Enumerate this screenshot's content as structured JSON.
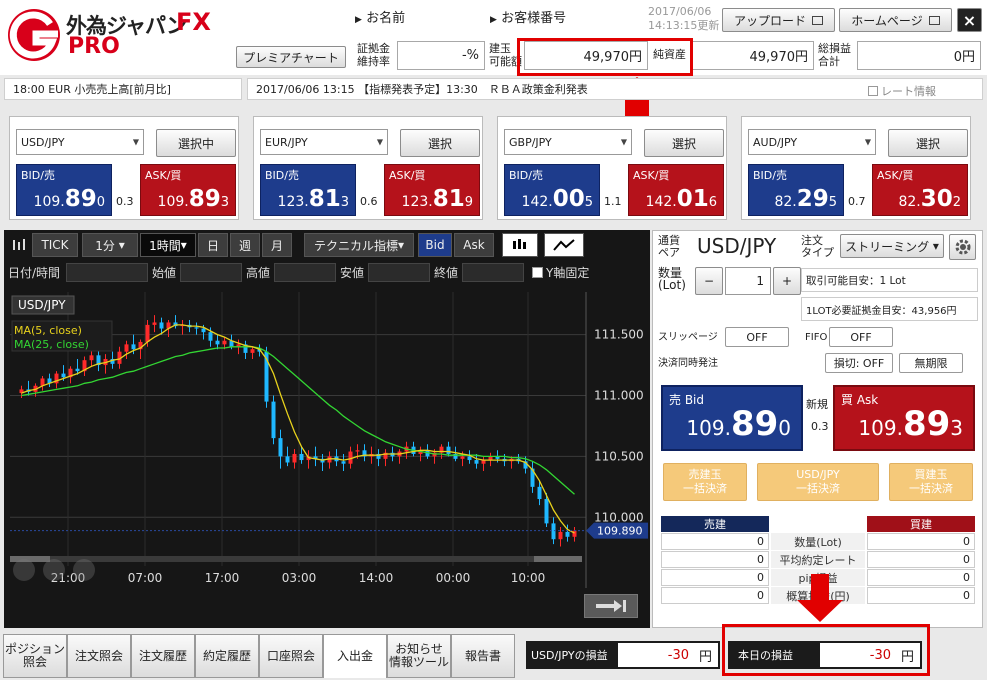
{
  "app": {
    "logo_main": "外為ジャパン",
    "logo_fx": "FX",
    "logo_pro": "PRO"
  },
  "header": {
    "name_label": "お名前",
    "customer_no_label": "お客様番号",
    "update_date": "2017/06/06",
    "update_time": "14:13:15更新",
    "upload_btn": "アップロード",
    "homepage_btn": "ホームページ",
    "close_btn": "×",
    "premier_chart_btn": "プレミアチャート",
    "margin_rate_label1": "証拠金",
    "margin_rate_label2": "維持率",
    "margin_rate_value": "-%",
    "position_avail_label1": "建玉",
    "position_avail_label2": "可能額",
    "position_avail_value": "49,970円",
    "net_assets_label": "純資産",
    "net_assets_value": "49,970円",
    "total_pl_label1": "総損益",
    "total_pl_label2": "合計",
    "total_pl_value": "0円"
  },
  "news": {
    "left": "18:00  EUR  小売売上高[前月比]",
    "main": "2017/06/06 13:15 【指標発表予定】13:30　ＲＢＡ政策金利発表",
    "rate_info_label": "レート情報"
  },
  "panels": [
    {
      "pair": "USD/JPY",
      "button": "選択中",
      "bid_label": "BID/売",
      "bid": [
        "109.",
        "89",
        "0"
      ],
      "ask_label": "ASK/買",
      "ask": [
        "109.",
        "89",
        "3"
      ],
      "spread": "0.3"
    },
    {
      "pair": "EUR/JPY",
      "button": "選択",
      "bid_label": "BID/売",
      "bid": [
        "123.",
        "81",
        "3"
      ],
      "ask_label": "ASK/買",
      "ask": [
        "123.",
        "81",
        "9"
      ],
      "spread": "0.6"
    },
    {
      "pair": "GBP/JPY",
      "button": "選択",
      "bid_label": "BID/売",
      "bid": [
        "142.",
        "00",
        "5"
      ],
      "ask_label": "ASK/買",
      "ask": [
        "142.",
        "01",
        "6"
      ],
      "spread": "1.1"
    },
    {
      "pair": "AUD/JPY",
      "button": "選択",
      "bid_label": "BID/売",
      "bid": [
        "82.",
        "29",
        "5"
      ],
      "ask_label": "ASK/買",
      "ask": [
        "82.",
        "30",
        "2"
      ],
      "spread": "0.7"
    }
  ],
  "chart_toolbar": {
    "tick": "TICK",
    "minute": "1分",
    "hour": "1時間",
    "day": "日",
    "week": "週",
    "month": "月",
    "technical": "テクニカル指標",
    "bid": "Bid",
    "ask": "Ask"
  },
  "ohlc": {
    "datetime": "日付/時間",
    "open": "始値",
    "high": "高値",
    "low": "安値",
    "close": "終値",
    "y_fixed": "Y軸固定"
  },
  "chart_data": {
    "type": "line",
    "symbol": "USD/JPY",
    "series": [
      {
        "name": "MA(5, close)",
        "color": "#e8d21c"
      },
      {
        "name": "MA(25, close)",
        "color": "#33d633"
      }
    ],
    "yticks": [
      "111.500",
      "111.000",
      "110.500",
      "110.000"
    ],
    "xticks": [
      "21:00",
      "07:00",
      "17:00",
      "03:00",
      "14:00",
      "00:00",
      "10:00"
    ],
    "ylim": [
      109.6,
      111.85
    ],
    "current_price": "109.890",
    "candles": [
      [
        111.02,
        111.08,
        110.98,
        111.05
      ],
      [
        111.05,
        111.12,
        111.0,
        111.03
      ],
      [
        111.03,
        111.1,
        110.99,
        111.08
      ],
      [
        111.08,
        111.16,
        111.04,
        111.14
      ],
      [
        111.14,
        111.18,
        111.07,
        111.1
      ],
      [
        111.1,
        111.2,
        111.06,
        111.18
      ],
      [
        111.18,
        111.25,
        111.12,
        111.15
      ],
      [
        111.15,
        111.24,
        111.1,
        111.22
      ],
      [
        111.22,
        111.3,
        111.17,
        111.2
      ],
      [
        111.2,
        111.32,
        111.16,
        111.29
      ],
      [
        111.29,
        111.38,
        111.24,
        111.33
      ],
      [
        111.33,
        111.4,
        111.2,
        111.25
      ],
      [
        111.25,
        111.34,
        111.18,
        111.3
      ],
      [
        111.3,
        111.36,
        111.22,
        111.26
      ],
      [
        111.26,
        111.4,
        111.22,
        111.36
      ],
      [
        111.36,
        111.45,
        111.3,
        111.42
      ],
      [
        111.42,
        111.5,
        111.34,
        111.38
      ],
      [
        111.38,
        111.46,
        111.3,
        111.44
      ],
      [
        111.44,
        111.62,
        111.4,
        111.58
      ],
      [
        111.58,
        111.66,
        111.52,
        111.6
      ],
      [
        111.6,
        111.64,
        111.5,
        111.55
      ],
      [
        111.55,
        111.62,
        111.48,
        111.6
      ],
      [
        111.6,
        111.66,
        111.55,
        111.57
      ],
      [
        111.57,
        111.62,
        111.5,
        111.58
      ],
      [
        111.58,
        111.62,
        111.52,
        111.56
      ],
      [
        111.56,
        111.6,
        111.5,
        111.55
      ],
      [
        111.55,
        111.58,
        111.46,
        111.52
      ],
      [
        111.52,
        111.56,
        111.4,
        111.45
      ],
      [
        111.45,
        111.5,
        111.38,
        111.42
      ],
      [
        111.42,
        111.48,
        111.38,
        111.45
      ],
      [
        111.45,
        111.5,
        111.38,
        111.4
      ],
      [
        111.4,
        111.46,
        111.34,
        111.42
      ],
      [
        111.42,
        111.45,
        111.3,
        111.35
      ],
      [
        111.35,
        111.4,
        111.3,
        111.38
      ],
      [
        111.38,
        111.42,
        111.32,
        111.36
      ],
      [
        111.36,
        111.4,
        110.9,
        110.95
      ],
      [
        110.95,
        111.0,
        110.6,
        110.65
      ],
      [
        110.65,
        110.72,
        110.4,
        110.5
      ],
      [
        110.5,
        110.58,
        110.42,
        110.45
      ],
      [
        110.45,
        110.56,
        110.4,
        110.52
      ],
      [
        110.52,
        110.58,
        110.44,
        110.47
      ],
      [
        110.47,
        110.55,
        110.4,
        110.5
      ],
      [
        110.5,
        110.58,
        110.42,
        110.48
      ],
      [
        110.48,
        110.52,
        110.38,
        110.45
      ],
      [
        110.45,
        110.54,
        110.4,
        110.5
      ],
      [
        110.5,
        110.56,
        110.42,
        110.46
      ],
      [
        110.46,
        110.52,
        110.38,
        110.44
      ],
      [
        110.44,
        110.58,
        110.4,
        110.54
      ],
      [
        110.54,
        110.6,
        110.48,
        110.55
      ],
      [
        110.55,
        110.6,
        110.46,
        110.5
      ],
      [
        110.5,
        110.58,
        110.44,
        110.52
      ],
      [
        110.52,
        110.56,
        110.42,
        110.48
      ],
      [
        110.48,
        110.56,
        110.42,
        110.53
      ],
      [
        110.53,
        110.58,
        110.46,
        110.5
      ],
      [
        110.5,
        110.56,
        110.44,
        110.54
      ],
      [
        110.54,
        110.62,
        110.48,
        110.58
      ],
      [
        110.58,
        110.62,
        110.5,
        110.52
      ],
      [
        110.52,
        110.58,
        110.46,
        110.55
      ],
      [
        110.55,
        110.6,
        110.48,
        110.5
      ],
      [
        110.5,
        110.56,
        110.44,
        110.53
      ],
      [
        110.53,
        110.6,
        110.48,
        110.58
      ],
      [
        110.58,
        110.62,
        110.5,
        110.52
      ],
      [
        110.52,
        110.58,
        110.46,
        110.48
      ],
      [
        110.48,
        110.54,
        110.42,
        110.5
      ],
      [
        110.5,
        110.55,
        110.44,
        110.47
      ],
      [
        110.47,
        110.52,
        110.4,
        110.44
      ],
      [
        110.44,
        110.5,
        110.38,
        110.47
      ],
      [
        110.47,
        110.53,
        110.42,
        110.5
      ],
      [
        110.5,
        110.55,
        110.45,
        110.48
      ],
      [
        110.48,
        110.52,
        110.42,
        110.46
      ],
      [
        110.46,
        110.5,
        110.4,
        110.48
      ],
      [
        110.48,
        110.52,
        110.44,
        110.46
      ],
      [
        110.46,
        110.5,
        110.36,
        110.4
      ],
      [
        110.4,
        110.46,
        110.2,
        110.25
      ],
      [
        110.25,
        110.3,
        110.1,
        110.15
      ],
      [
        110.15,
        110.2,
        109.92,
        109.95
      ],
      [
        109.95,
        110.0,
        109.78,
        109.82
      ],
      [
        109.82,
        109.92,
        109.76,
        109.88
      ],
      [
        109.88,
        109.94,
        109.8,
        109.84
      ],
      [
        109.84,
        109.92,
        109.8,
        109.89
      ]
    ],
    "ma5": [
      111.02,
      111.04,
      111.05,
      111.08,
      111.1,
      111.12,
      111.14,
      111.16,
      111.18,
      111.21,
      111.24,
      111.26,
      111.27,
      111.29,
      111.3,
      111.34,
      111.37,
      111.39,
      111.44,
      111.48,
      111.51,
      111.55,
      111.58,
      111.58,
      111.57,
      111.57,
      111.56,
      111.53,
      111.5,
      111.48,
      111.45,
      111.43,
      111.41,
      111.4,
      111.38,
      111.3,
      111.18,
      111.01,
      110.85,
      110.7,
      110.58,
      110.49,
      110.48,
      110.47,
      110.48,
      110.48,
      110.47,
      110.48,
      110.5,
      110.51,
      110.51,
      110.51,
      110.52,
      110.52,
      110.52,
      110.53,
      110.54,
      110.55,
      110.55,
      110.54,
      110.54,
      110.54,
      110.53,
      110.52,
      110.51,
      110.48,
      110.47,
      110.47,
      110.47,
      110.47,
      110.47,
      110.47,
      110.45,
      110.39,
      110.3,
      110.18,
      110.06,
      109.97,
      109.9,
      109.87
    ],
    "ma25": [
      111.0,
      111.01,
      111.02,
      111.03,
      111.04,
      111.05,
      111.06,
      111.07,
      111.08,
      111.1,
      111.11,
      111.13,
      111.14,
      111.15,
      111.17,
      111.19,
      111.2,
      111.22,
      111.24,
      111.26,
      111.28,
      111.3,
      111.32,
      111.33,
      111.35,
      111.36,
      111.37,
      111.38,
      111.39,
      111.39,
      111.4,
      111.4,
      111.4,
      111.4,
      111.39,
      111.36,
      111.32,
      111.27,
      111.22,
      111.17,
      111.12,
      111.07,
      111.02,
      110.97,
      110.92,
      110.88,
      110.83,
      110.79,
      110.75,
      110.71,
      110.68,
      110.65,
      110.62,
      110.6,
      110.58,
      110.56,
      110.55,
      110.54,
      110.53,
      110.52,
      110.52,
      110.51,
      110.51,
      110.51,
      110.51,
      110.51,
      110.5,
      110.5,
      110.5,
      110.5,
      110.49,
      110.49,
      110.48,
      110.46,
      110.43,
      110.39,
      110.34,
      110.29,
      110.24,
      110.19
    ]
  },
  "order": {
    "pair_label1": "通貨",
    "pair_label2": "ペア",
    "pair": "USD/JPY",
    "type_label1": "注文",
    "type_label2": "タイプ",
    "type_value": "ストリーミング",
    "qty_label1": "数量",
    "qty_label2": "(Lot)",
    "minus": "−",
    "qty_value": "1",
    "plus": "+",
    "min_lot": "取引可能目安：1 Lot",
    "margin_needed": "1LOT必要証拠金目安：43,956円",
    "slippage_label": "スリッページ",
    "slippage_value": "OFF",
    "fifo_label": "FIFO",
    "fifo_value": "OFF",
    "settle_label": "決済同時発注",
    "stoploss_value": "損切: OFF",
    "unlimited_value": "無期限",
    "sell_label": "売 Bid",
    "sell_price": [
      "109.",
      "89",
      "0"
    ],
    "new_label": "新規",
    "spread": "0.3",
    "buy_label": "買 Ask",
    "buy_price": [
      "109.",
      "89",
      "3"
    ],
    "bulk_sell1": "売建玉",
    "bulk_sell2": "一括決済",
    "bulk_pair1": "USD/JPY",
    "bulk_pair2": "一括決済",
    "bulk_buy1": "買建玉",
    "bulk_buy2": "一括決済",
    "pos_sell_header": "売建",
    "pos_buy_header": "買建",
    "pos_rows": [
      {
        "label": "数量(Lot)",
        "sell": "0",
        "buy": "0"
      },
      {
        "label": "平均約定レート",
        "sell": "0",
        "buy": "0"
      },
      {
        "label": "pip損益",
        "sell": "0",
        "buy": "0"
      },
      {
        "label": "概算損益(円)",
        "sell": "0",
        "buy": "0"
      }
    ]
  },
  "bottom_tabs": [
    {
      "line1": "ポジション",
      "line2": "照会"
    },
    {
      "line1": "注文照会",
      "line2": ""
    },
    {
      "line1": "注文履歴",
      "line2": ""
    },
    {
      "line1": "約定履歴",
      "line2": ""
    },
    {
      "line1": "口座照会",
      "line2": ""
    },
    {
      "line1": "入出金",
      "line2": ""
    },
    {
      "line1": "お知らせ",
      "line2": "情報ツール"
    },
    {
      "line1": "報告書",
      "line2": ""
    }
  ],
  "pl": {
    "pair_pl_label": "USD/JPYの損益",
    "pair_pl_value": "-30",
    "pair_pl_unit": "円",
    "today_pl_label": "本日の損益",
    "today_pl_value": "-30",
    "today_pl_unit": "円"
  },
  "colors": {
    "bid_blue": "#1e3c8c",
    "ask_red": "#b5121b",
    "highlight_red": "#e10000",
    "arrow_red": "#e10000"
  }
}
